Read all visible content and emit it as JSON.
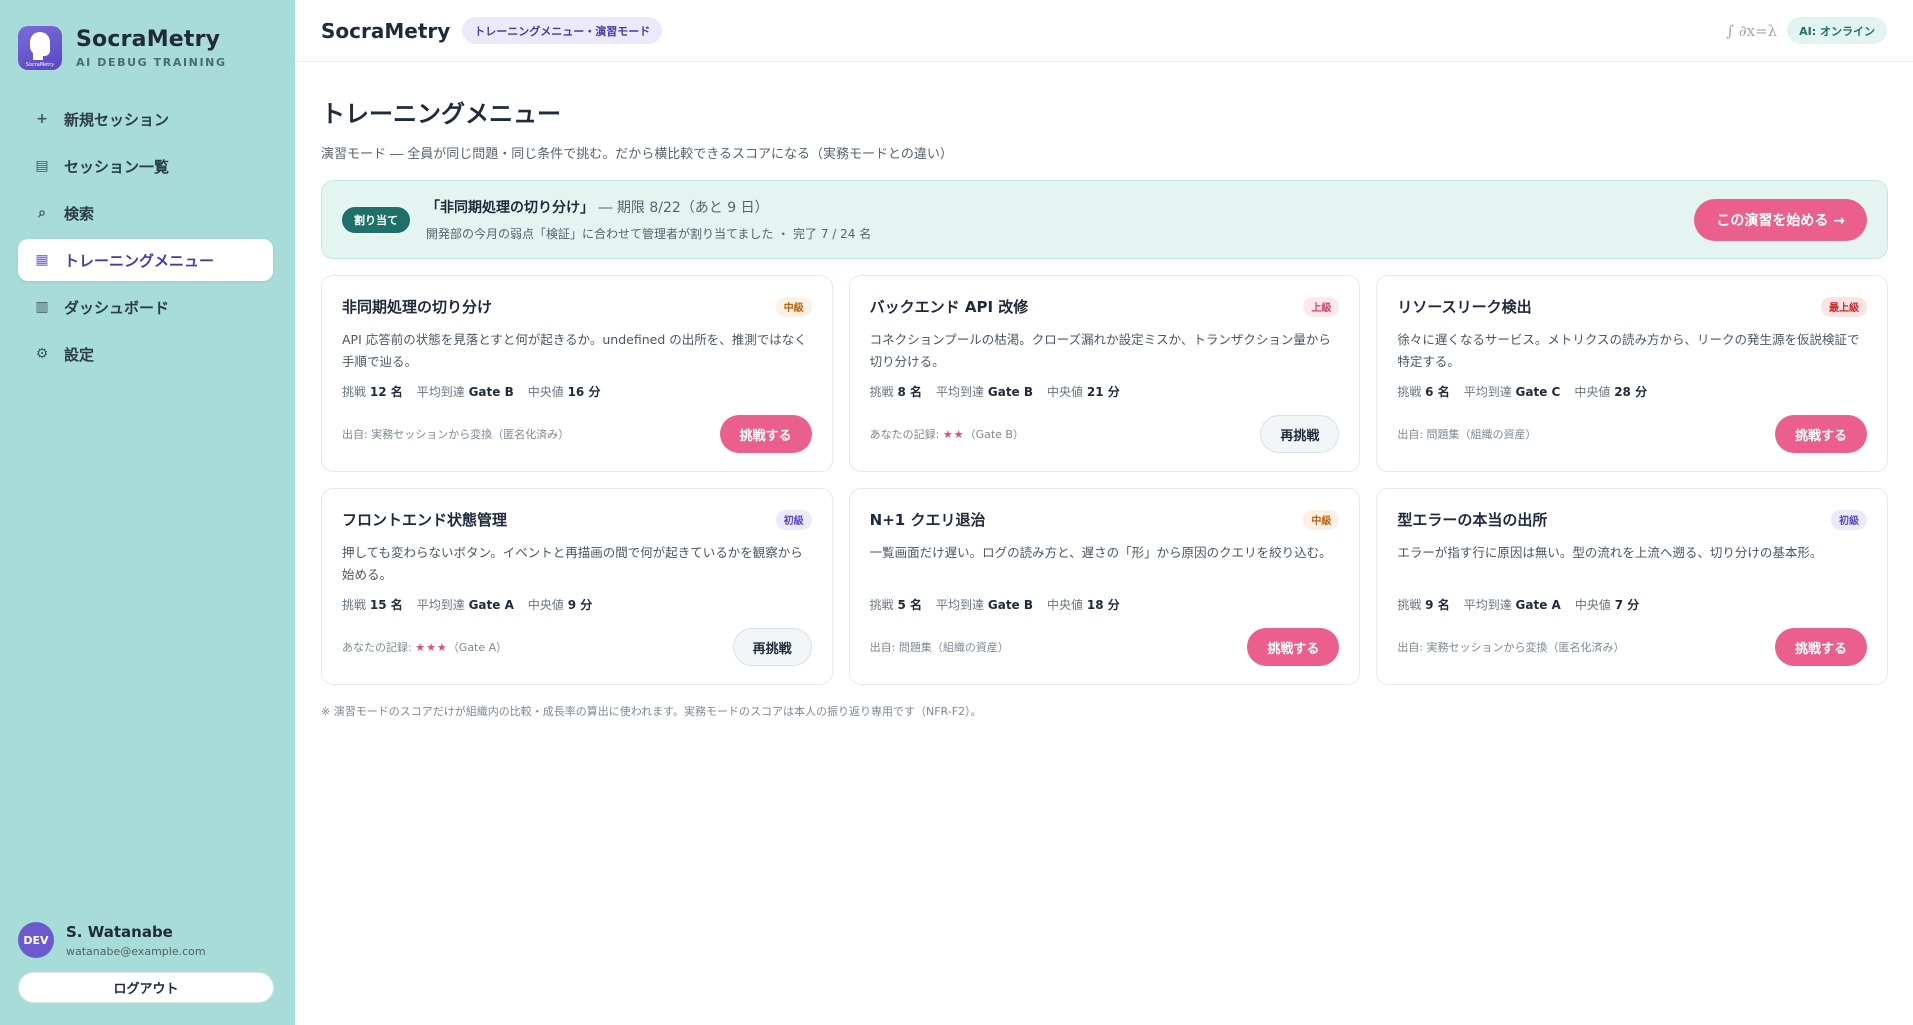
{
  "sidebar": {
    "brand_title": "SocraMetry",
    "brand_sub": "AI DEBUG TRAINING",
    "logo_text": "SocraMetry",
    "items": [
      {
        "label": "新規セッション",
        "icon": "plus-icon",
        "glyph": "+"
      },
      {
        "label": "セッション一覧",
        "icon": "list-icon",
        "glyph": "▤"
      },
      {
        "label": "検索",
        "icon": "search-icon",
        "glyph": "⌕"
      },
      {
        "label": "トレーニングメニュー",
        "icon": "grid-icon",
        "glyph": "▦",
        "active": true
      },
      {
        "label": "ダッシュボード",
        "icon": "dashboard-icon",
        "glyph": "▥"
      },
      {
        "label": "設定",
        "icon": "gear-icon",
        "glyph": "⚙"
      }
    ],
    "user": {
      "avatar": "DEV",
      "name": "S. Watanabe",
      "email": "watanabe@example.com",
      "logout": "ログアウト"
    }
  },
  "topbar": {
    "title": "SocraMetry",
    "mode": "トレーニングメニュー・演習モード",
    "math": "∫ ∂x=λ",
    "ai_status": "AI: オンライン"
  },
  "page": {
    "title": "トレーニングメニュー",
    "subtitle": "演習モード ― 全員が同じ問題・同じ条件で挑む。だから横比較できるスコアになる（実務モードとの違い）"
  },
  "assignment": {
    "badge": "割り当て",
    "title": "「非同期処理の切り分け」",
    "deadline": " ― 期限 8/22（あと 9 日）",
    "desc": "開発部の今月の弱点「検証」に合わせて管理者が割り当てました ・ 完了 7 / 24 名",
    "button": "この演習を始める →"
  },
  "labels": {
    "challengers": "挑戦",
    "avg_reach": "平均到達",
    "median": "中央値"
  },
  "colors": {
    "accent_pink": "#ea5f8c",
    "teal": "#1f7068",
    "sidebar_bg": "#a8dcd8",
    "purple": "#6a5acd"
  },
  "cards": [
    {
      "title": "非同期処理の切り分け",
      "level": "中級",
      "level_bg": "#fdf0e4",
      "level_color": "#c0620f",
      "desc": "API 応答前の状態を見落とすと何が起きるか。undefined の出所を、推測ではなく手順で辿る。",
      "challengers": "12 名",
      "avg": "Gate B",
      "median": "16 分",
      "origin": "出自: 実務セッションから変換（匿名化済み）",
      "stars": "",
      "record_suffix": "",
      "button": "挑戦する",
      "button_style": "primary"
    },
    {
      "title": "バックエンド API 改修",
      "level": "上級",
      "level_bg": "#fde8ee",
      "level_color": "#d04068",
      "desc": "コネクションプールの枯渇。クローズ漏れか設定ミスか、トランザクション量から切り分ける。",
      "challengers": "8 名",
      "avg": "Gate B",
      "median": "21 分",
      "origin": "あなたの記録: ",
      "stars": "★★",
      "record_suffix": "（Gate B）",
      "button": "再挑戦",
      "button_style": "secondary"
    },
    {
      "title": "リソースリーク検出",
      "level": "最上級",
      "level_bg": "#fde2e2",
      "level_color": "#c42b2b",
      "desc": "徐々に遅くなるサービス。メトリクスの読み方から、リークの発生源を仮説検証で特定する。",
      "challengers": "6 名",
      "avg": "Gate C",
      "median": "28 分",
      "origin": "出自: 問題集（組織の資産）",
      "stars": "",
      "record_suffix": "",
      "button": "挑戦する",
      "button_style": "primary"
    },
    {
      "title": "フロントエンド状態管理",
      "level": "初級",
      "level_bg": "#ece9fb",
      "level_color": "#5a48c0",
      "desc": "押しても変わらないボタン。イベントと再描画の間で何が起きているかを観察から始める。",
      "challengers": "15 名",
      "avg": "Gate A",
      "median": "9 分",
      "origin": "あなたの記録: ",
      "stars": "★★★",
      "record_suffix": "（Gate A）",
      "button": "再挑戦",
      "button_style": "secondary"
    },
    {
      "title": "N+1 クエリ退治",
      "level": "中級",
      "level_bg": "#fdf0e4",
      "level_color": "#c0620f",
      "desc": "一覧画面だけ遅い。ログの読み方と、遅さの「形」から原因のクエリを絞り込む。",
      "challengers": "5 名",
      "avg": "Gate B",
      "median": "18 分",
      "origin": "出自: 問題集（組織の資産）",
      "stars": "",
      "record_suffix": "",
      "button": "挑戦する",
      "button_style": "primary"
    },
    {
      "title": "型エラーの本当の出所",
      "level": "初級",
      "level_bg": "#ece9fb",
      "level_color": "#5a48c0",
      "desc": "エラーが指す行に原因は無い。型の流れを上流へ遡る、切り分けの基本形。",
      "challengers": "9 名",
      "avg": "Gate A",
      "median": "7 分",
      "origin": "出自: 実務セッションから変換（匿名化済み）",
      "stars": "",
      "record_suffix": "",
      "button": "挑戦する",
      "button_style": "primary"
    }
  ],
  "footnote": "※ 演習モードのスコアだけが組織内の比較・成長率の算出に使われます。実務モードのスコアは本人の振り返り専用です（NFR-F2）。"
}
